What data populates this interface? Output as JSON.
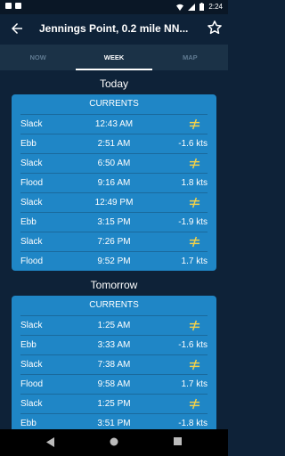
{
  "status": {
    "time": "2:24"
  },
  "header": {
    "title": "Jennings Point, 0.2 mile NN..."
  },
  "tabs": [
    {
      "label": "NOW"
    },
    {
      "label": "WEEK"
    },
    {
      "label": "MAP"
    }
  ],
  "days": [
    {
      "label": "Today",
      "heading": "CURRENTS",
      "rows": [
        {
          "type": "Slack",
          "time": "12:43 AM",
          "value": ""
        },
        {
          "type": "Ebb",
          "time": "2:51 AM",
          "value": "-1.6 kts"
        },
        {
          "type": "Slack",
          "time": "6:50 AM",
          "value": ""
        },
        {
          "type": "Flood",
          "time": "9:16 AM",
          "value": "1.8 kts"
        },
        {
          "type": "Slack",
          "time": "12:49 PM",
          "value": ""
        },
        {
          "type": "Ebb",
          "time": "3:15 PM",
          "value": "-1.9 kts"
        },
        {
          "type": "Slack",
          "time": "7:26 PM",
          "value": ""
        },
        {
          "type": "Flood",
          "time": "9:52 PM",
          "value": "1.7 kts"
        }
      ]
    },
    {
      "label": "Tomorrow",
      "heading": "CURRENTS",
      "rows": [
        {
          "type": "Slack",
          "time": "1:25 AM",
          "value": ""
        },
        {
          "type": "Ebb",
          "time": "3:33 AM",
          "value": "-1.6 kts"
        },
        {
          "type": "Slack",
          "time": "7:38 AM",
          "value": ""
        },
        {
          "type": "Flood",
          "time": "9:58 AM",
          "value": "1.7 kts"
        },
        {
          "type": "Slack",
          "time": "1:25 PM",
          "value": ""
        },
        {
          "type": "Ebb",
          "time": "3:51 PM",
          "value": "-1.8 kts"
        }
      ]
    }
  ],
  "colors": {
    "background": "#0e2238",
    "card": "#1f86c6",
    "slack_icon": "#f2d14a"
  }
}
